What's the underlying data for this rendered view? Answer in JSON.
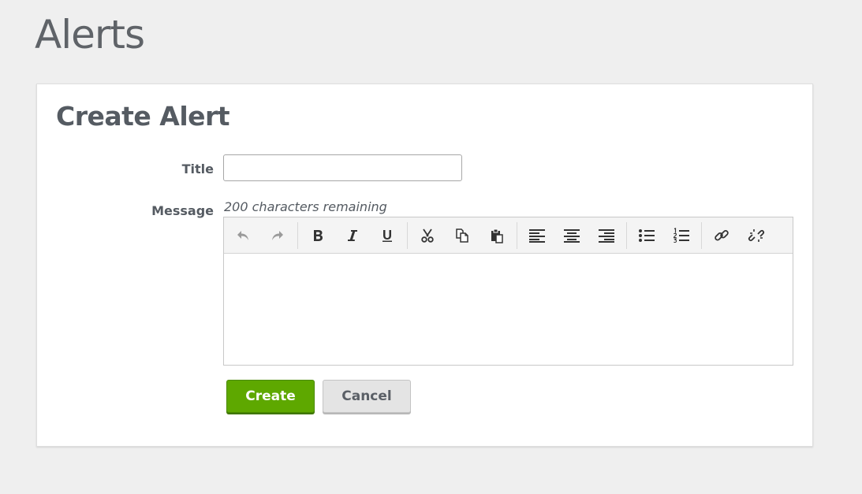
{
  "page": {
    "title": "Alerts"
  },
  "form": {
    "heading": "Create Alert",
    "title_label": "Title",
    "title_value": "",
    "message_label": "Message",
    "char_count": "200 characters remaining",
    "message_value": ""
  },
  "toolbar": {
    "groups": [
      [
        "undo-icon",
        "redo-icon"
      ],
      [
        "bold-icon",
        "italic-icon",
        "underline-icon"
      ],
      [
        "cut-icon",
        "copy-icon",
        "paste-icon"
      ],
      [
        "align-left-icon",
        "align-center-icon",
        "align-right-icon"
      ],
      [
        "bullet-list-icon",
        "numbered-list-icon"
      ],
      [
        "link-icon",
        "unlink-icon"
      ]
    ]
  },
  "actions": {
    "create_label": "Create",
    "cancel_label": "Cancel"
  },
  "colors": {
    "primary": "#5ea800",
    "background": "#efefef",
    "text": "#555b62"
  }
}
